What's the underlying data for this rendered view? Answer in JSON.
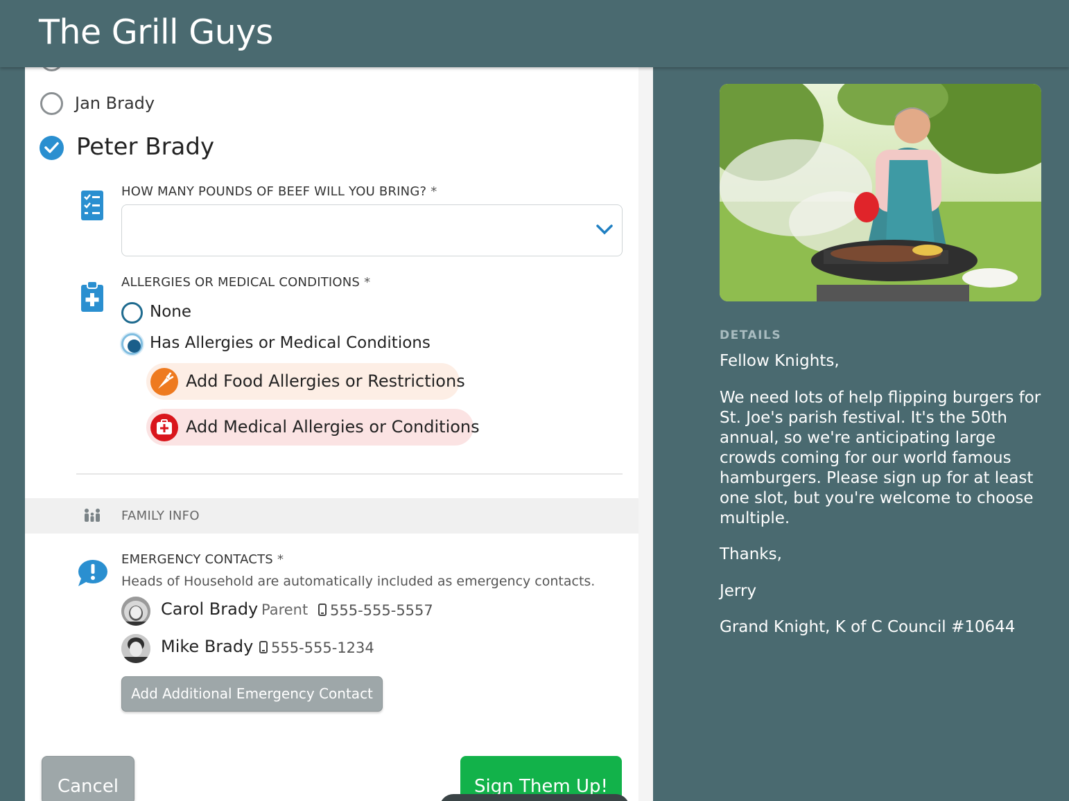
{
  "header": {
    "title": "The Grill Guys"
  },
  "people": {
    "jan": "Jan Brady",
    "peter": "Peter Brady"
  },
  "questions": {
    "beef": {
      "label": "HOW MANY POUNDS OF BEEF WILL YOU BRING?",
      "required_mark": "*",
      "value": ""
    },
    "allergies": {
      "label": "ALLERGIES OR MEDICAL CONDITIONS",
      "required_mark": "*",
      "options": [
        "None",
        "Has Allergies or Medical Conditions"
      ],
      "selected": "Has Allergies or Medical Conditions",
      "add_food": "Add Food Allergies or Restrictions",
      "add_medical": "Add Medical Allergies or Conditions"
    }
  },
  "family_info": {
    "section_label": "FAMILY INFO",
    "emergency_label": "EMERGENCY CONTACTS",
    "required_mark": "*",
    "help_text": "Heads of Household are automatically included as emergency contacts.",
    "contacts": [
      {
        "name": "Carol Brady",
        "role": "Parent",
        "phone": "555-555-5557"
      },
      {
        "name": "Mike Brady",
        "role": "",
        "phone": "555-555-1234"
      }
    ],
    "add_contact_button": "Add Additional Emergency Contact"
  },
  "actions": {
    "cancel": "Cancel",
    "submit": "Sign Them Up!"
  },
  "details": {
    "label": "DETAILS",
    "greeting": "Fellow Knights,",
    "body": "We need lots of help flipping burgers for St. Joe's parish festival. It's the 50th annual, so we're anticipating large crowds coming for our world famous hamburgers. Please sign up for at least one slot, but you're welcome to choose multiple.",
    "thanks": "Thanks,",
    "signature": "Jerry",
    "title": "Grand Knight, K of C Council #10644"
  },
  "colors": {
    "header_bg": "#4a6a70",
    "accent_blue": "#2a8fd0",
    "submit_green": "#12b24a",
    "food_orange": "#ee7a1f",
    "medical_red": "#d9161c"
  }
}
